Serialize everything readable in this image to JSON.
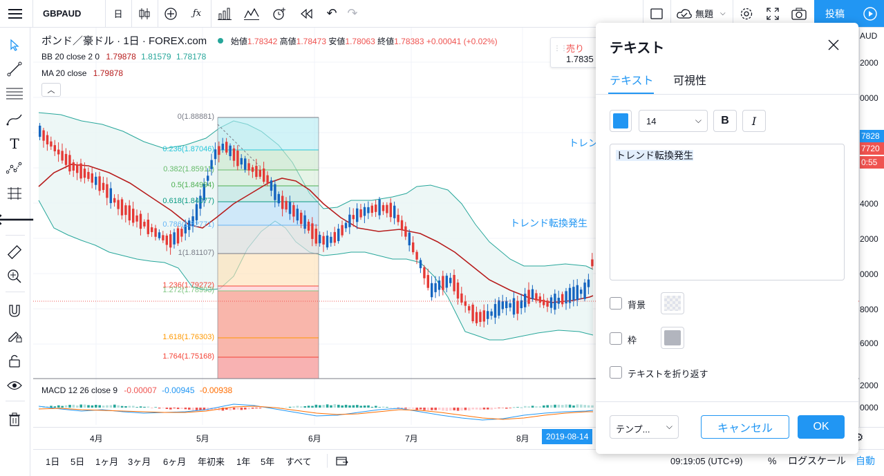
{
  "toolbar": {
    "symbol": "GBPAUD",
    "interval": "日",
    "layout_name": "無題",
    "publish_label": "投稿"
  },
  "legend": {
    "title": "ポンド／豪ドル · 1日 · FOREX.com",
    "open_label": "始値",
    "open": "1.78342",
    "high_label": "高値",
    "high": "1.78473",
    "low_label": "安値",
    "low": "1.78063",
    "close_label": "終値",
    "close": "1.78383",
    "change": "+0.00041 (+0.02%)",
    "bb_label": "BB 20 close 2 0",
    "bb1": "1.79878",
    "bb2": "1.81579",
    "bb3": "1.78178",
    "ma_label": "MA 20 close",
    "ma": "1.79878",
    "macd_label": "MACD 12 26 close 9",
    "macd1": "-0.00007",
    "macd2": "-0.00945",
    "macd3": "-0.00938"
  },
  "sell_box": {
    "label": "売り",
    "price": "1.7835"
  },
  "fib_levels": [
    {
      "label": "0(1.88881)"
    },
    {
      "label": "0.236(1.87046)"
    },
    {
      "label": "0.382(1.85911)"
    },
    {
      "label": "0.5(1.84994)"
    },
    {
      "label": "0.618(1.84077)"
    },
    {
      "label": "0.786(1.82771)"
    },
    {
      "label": "1(1.81107)"
    },
    {
      "label": "1.236(1.79272)"
    },
    {
      "label": "1.272(1.78993)"
    },
    {
      "label": "1.618(1.76303)"
    },
    {
      "label": "1.764(1.75168)"
    }
  ],
  "annotations": {
    "text1": "トレン",
    "text2": "トレンド転換発生"
  },
  "price_axis": {
    "labels": [
      "2000",
      "0000",
      "4000",
      "2000",
      "0000",
      "8000",
      "6000",
      "AUD"
    ],
    "current1": "7828",
    "current2": "7720",
    "countdown": "0:55",
    "macd_labels": [
      "2000",
      "0000"
    ]
  },
  "time_axis": {
    "labels": [
      "4月",
      "5月",
      "6月",
      "7月",
      "8月"
    ],
    "highlight": "2019-08-14"
  },
  "bottombar": {
    "ranges": [
      "1日",
      "5日",
      "1ヶ月",
      "3ヶ月",
      "6ヶ月",
      "年初来",
      "1年",
      "5年",
      "すべて"
    ],
    "time": "09:19:05 (UTC+9)",
    "percent": "%",
    "log": "ログスケール",
    "auto": "自動"
  },
  "dialog": {
    "title": "テキスト",
    "tabs": [
      "テキスト",
      "可視性"
    ],
    "font_size": "14",
    "bold": "B",
    "italic": "I",
    "text_value": "トレンド転換発生",
    "background_label": "背景",
    "border_label": "枠",
    "wrap_label": "テキストを折り返す",
    "template_label": "テンプ...",
    "cancel_label": "キャンセル",
    "ok_label": "OK",
    "color": "#2196f3"
  }
}
